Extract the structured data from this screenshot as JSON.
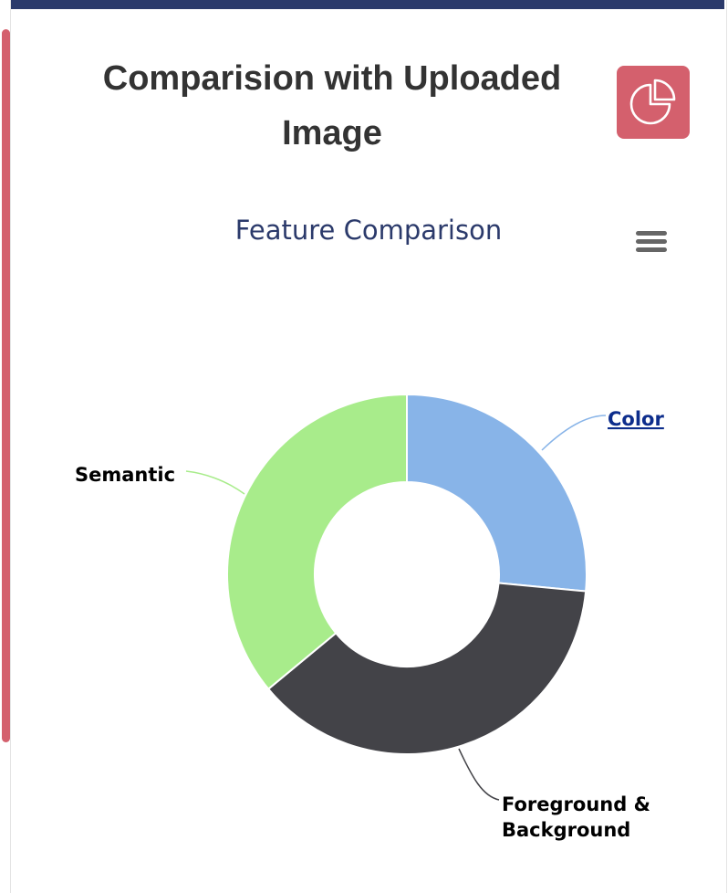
{
  "card": {
    "title": "Comparision with Uploaded Image",
    "icon": "pie-chart-icon",
    "accent_color": "#d4606d",
    "header_bar_color": "#2b3a6b"
  },
  "chart_menu": {
    "icon": "hamburger-menu-icon"
  },
  "chart_data": {
    "type": "pie",
    "title": "Feature Comparison",
    "donut": true,
    "categories": [
      "Color",
      "Foreground & Background",
      "Semantic"
    ],
    "values": [
      26.5,
      37.5,
      36
    ],
    "colors": [
      "#88b4e8",
      "#434348",
      "#a8ec8b"
    ],
    "legend": "none",
    "data_labels": true
  }
}
